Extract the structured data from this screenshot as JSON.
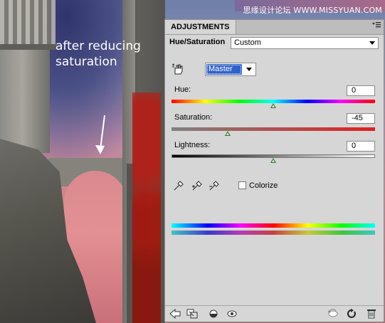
{
  "overlay": {
    "caption_line1": "after reducing",
    "caption_line2": "saturation",
    "watermark": "思缘设计论坛 WWW.MISSYUAN.COM"
  },
  "panel": {
    "tab_title": "ADJUSTMENTS",
    "menu_icon": "panel-menu-icon",
    "adjustment_name": "Hue/Saturation",
    "preset_value": "Custom",
    "channel_value": "Master",
    "hue": {
      "label": "Hue:",
      "value": "0",
      "fraction": 0.5
    },
    "saturation": {
      "label": "Saturation:",
      "value": "-45",
      "fraction": 0.275
    },
    "lightness": {
      "label": "Lightness:",
      "value": "0",
      "fraction": 0.5
    },
    "colorize_label": "Colorize",
    "colorize_checked": false,
    "footer_icons": [
      "back-arrow-icon",
      "clip-to-layer-icon",
      "visibility-toggle-icon",
      "eye-icon",
      "previous-state-icon",
      "reset-icon",
      "trash-icon"
    ],
    "colors": {
      "panel_bg": "#d6d6d6",
      "channel_highlight": "#2f62c8",
      "thumb": "#2b7a2b"
    }
  }
}
